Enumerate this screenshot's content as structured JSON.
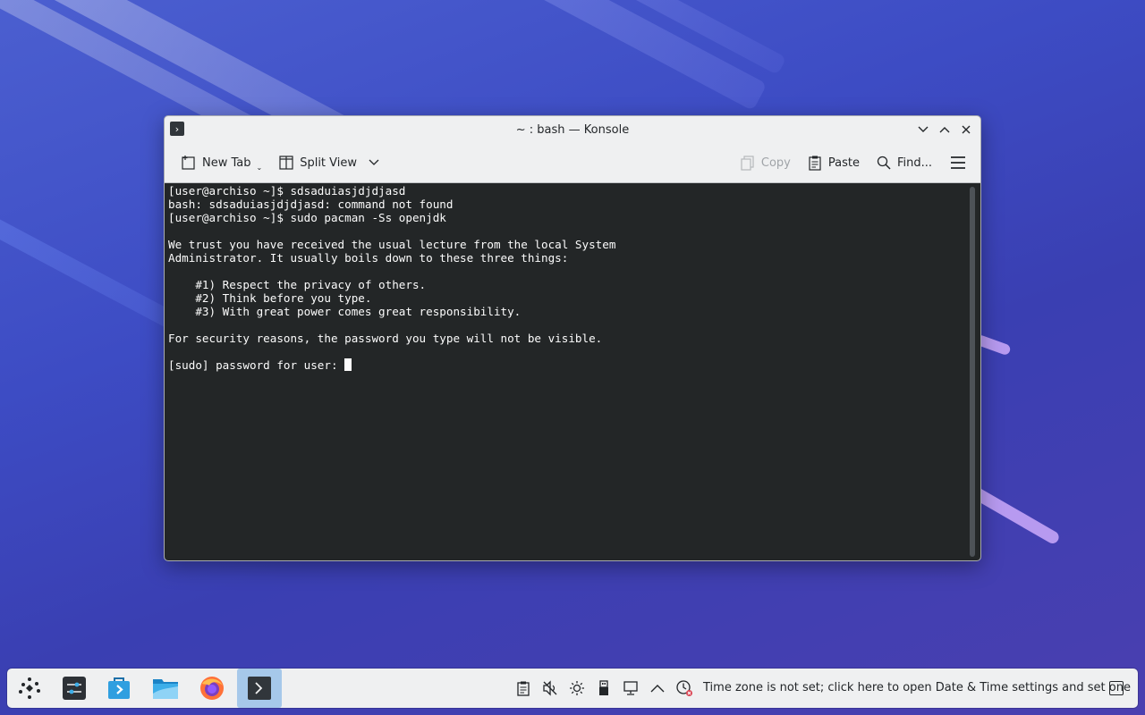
{
  "window": {
    "title": "~ : bash — Konsole",
    "buttons": {
      "minimize": "minimize",
      "maximize": "maximize",
      "close": "close"
    }
  },
  "toolbar": {
    "new_tab_label": "New Tab",
    "split_view_label": "Split View",
    "copy_label": "Copy",
    "paste_label": "Paste",
    "find_label": "Find..."
  },
  "terminal": {
    "lines": [
      "[user@archiso ~]$ sdsaduiasjdjdjasd",
      "bash: sdsaduiasjdjdjasd: command not found",
      "[user@archiso ~]$ sudo pacman -Ss openjdk",
      "",
      "We trust you have received the usual lecture from the local System",
      "Administrator. It usually boils down to these three things:",
      "",
      "    #1) Respect the privacy of others.",
      "    #2) Think before you type.",
      "    #3) With great power comes great responsibility.",
      "",
      "For security reasons, the password you type will not be visible.",
      "",
      "[sudo] password for user: "
    ]
  },
  "taskbar": {
    "apps": [
      "application-launcher-icon",
      "system-settings-icon",
      "discover-icon",
      "file-manager-icon",
      "firefox-icon",
      "konsole-icon"
    ],
    "tray": [
      "clipboard-icon",
      "volume-muted-icon",
      "brightness-icon",
      "usb-device-icon",
      "network-icon",
      "expand-tray-icon",
      "clock-warning-icon"
    ],
    "timezone_message": "Time zone is not set; click here to open Date & Time settings and set one"
  },
  "colors": {
    "terminal_bg": "#232627",
    "terminal_fg": "#fcfcfc",
    "active_task": "#a6c8ea",
    "panel_bg": "#eff0f1"
  }
}
